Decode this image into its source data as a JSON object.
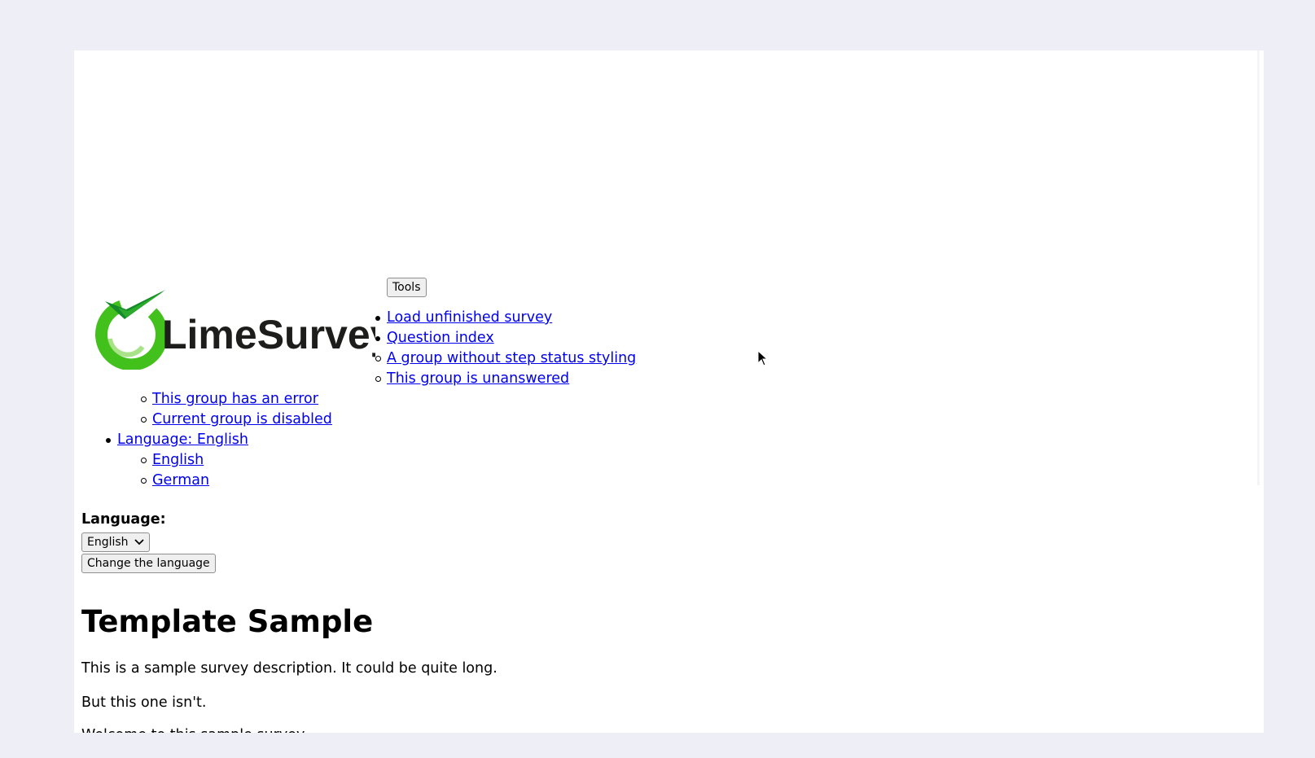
{
  "toolbar": {
    "tools_label": "Tools"
  },
  "logo": {
    "text": "LimeSurvey"
  },
  "menu": {
    "items": [
      {
        "label": "Load unfinished survey"
      },
      {
        "label": "Question index"
      }
    ],
    "groups": [
      {
        "label": "A group without step status styling"
      },
      {
        "label": "This group is unanswered"
      },
      {
        "label": "This group has an error"
      },
      {
        "label": "Current group is disabled"
      }
    ],
    "language": {
      "label": "Language: English",
      "options": [
        {
          "label": "English"
        },
        {
          "label": "German"
        }
      ]
    }
  },
  "language_form": {
    "label": "Language:",
    "selected": "English",
    "submit_label": "Change the language"
  },
  "survey": {
    "title": "Template Sample",
    "description_1": "This is a sample survey description. It could be quite long.",
    "description_2": "But this one isn't.",
    "welcome": "Welcome to this sample survey"
  },
  "colors": {
    "page_background": "#eeeef7",
    "link": "#0000ee",
    "logo_green": "#2db52d",
    "logo_dark_green": "#148a28"
  }
}
